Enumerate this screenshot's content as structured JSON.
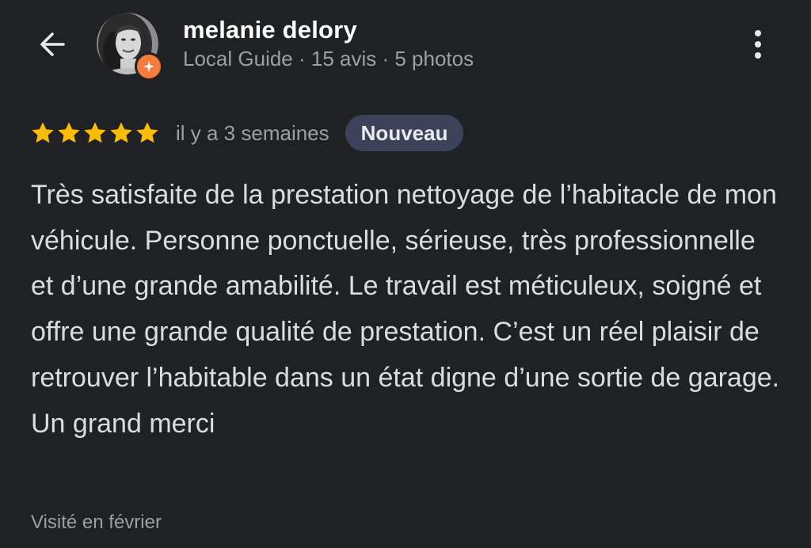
{
  "header": {
    "back_icon": "arrow-left-icon",
    "user_name": "melanie delory",
    "user_meta": "Local Guide · 15 avis · 5 photos",
    "badge_icon": "local-guide-star-icon",
    "badge_color": "#f47b3c",
    "more_icon": "more-vertical-icon"
  },
  "review": {
    "rating": 5,
    "max_rating": 5,
    "star_color": "#fbbc04",
    "date": "il y a 3 semaines",
    "badge": "Nouveau",
    "text": "Très satisfaite de la prestation nettoyage de l’habitacle de mon véhicule. Personne ponctuelle, sérieuse, très professionnelle et d’une grande amabilité. Le travail est méticuleux, soigné et offre une grande qualité de prestation. C’est un réel plaisir de retrouver l’habitable dans un état digne d’une sortie de garage. Un grand merci",
    "visited": "Visité en février"
  },
  "colors": {
    "background": "#202124",
    "badge_bg": "#3c4257"
  }
}
